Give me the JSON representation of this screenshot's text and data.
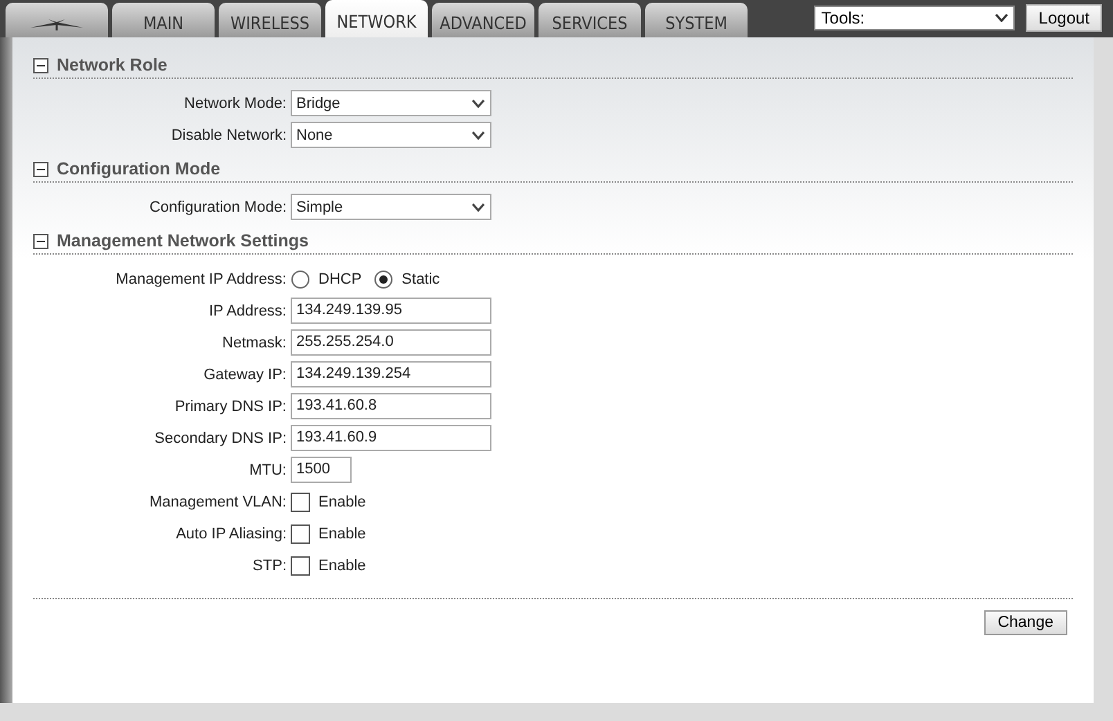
{
  "tabs": [
    {
      "label": "MAIN",
      "selected": false
    },
    {
      "label": "WIRELESS",
      "selected": false
    },
    {
      "label": "NETWORK",
      "selected": true
    },
    {
      "label": "ADVANCED",
      "selected": false
    },
    {
      "label": "SERVICES",
      "selected": false
    },
    {
      "label": "SYSTEM",
      "selected": false
    }
  ],
  "tools": {
    "value": "Tools:"
  },
  "logout": "Logout",
  "sections": [
    {
      "title": "Network Role",
      "expanded": true,
      "rows": [
        {
          "kind": "select",
          "label": "Network Mode:",
          "value": "Bridge"
        },
        {
          "kind": "select",
          "label": "Disable Network:",
          "value": "None"
        }
      ]
    },
    {
      "title": "Configuration Mode",
      "expanded": true,
      "rows": [
        {
          "kind": "select",
          "label": "Configuration Mode:",
          "value": "Simple"
        }
      ]
    },
    {
      "title": "Management Network Settings",
      "expanded": true,
      "rows": [
        {
          "kind": "radio",
          "label": "Management IP Address:",
          "options": [
            {
              "label": "DHCP",
              "selected": false
            },
            {
              "label": "Static",
              "selected": true
            }
          ]
        },
        {
          "kind": "text",
          "label": "IP Address:",
          "value": "134.249.139.95"
        },
        {
          "kind": "text",
          "label": "Netmask:",
          "value": "255.255.254.0"
        },
        {
          "kind": "text",
          "label": "Gateway IP:",
          "value": "134.249.139.254"
        },
        {
          "kind": "text",
          "label": "Primary DNS IP:",
          "value": "193.41.60.8"
        },
        {
          "kind": "text",
          "label": "Secondary DNS IP:",
          "value": "193.41.60.9"
        },
        {
          "kind": "short",
          "label": "MTU:",
          "value": "1500"
        },
        {
          "kind": "checkbox",
          "label": "Management VLAN:",
          "text": "Enable",
          "checked": false
        },
        {
          "kind": "checkbox",
          "label": "Auto IP Aliasing:",
          "text": "Enable",
          "checked": false
        },
        {
          "kind": "checkbox",
          "label": "STP:",
          "text": "Enable",
          "checked": false
        }
      ]
    }
  ],
  "change": "Change"
}
